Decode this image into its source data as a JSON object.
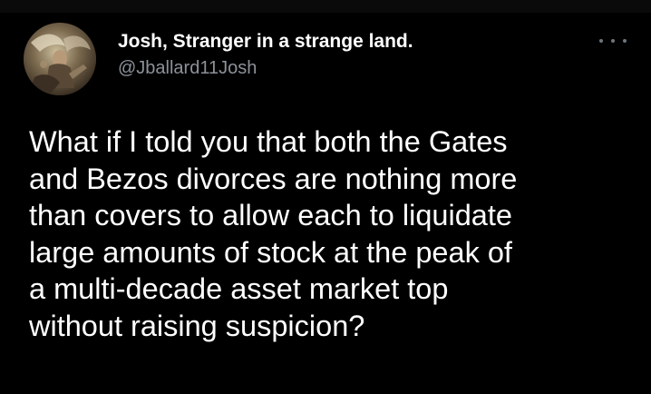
{
  "tweet": {
    "author": {
      "display_name": "Josh, Stranger in a strange land.",
      "handle": "@Jballard11Josh",
      "avatar_icon": "painted-angel-avatar"
    },
    "more_icon": "ellipsis-icon",
    "text_lines": [
      "What if I told you that both the Gates",
      "and Bezos divorces are nothing more",
      "than covers to allow each to liquidate",
      "large amounts of stock at the peak of",
      "a multi-decade asset market top",
      "without raising suspicion?"
    ]
  },
  "colors": {
    "background": "#000000",
    "text": "#ffffff",
    "secondary_text": "#8b9299",
    "icon": "#6e767d"
  }
}
